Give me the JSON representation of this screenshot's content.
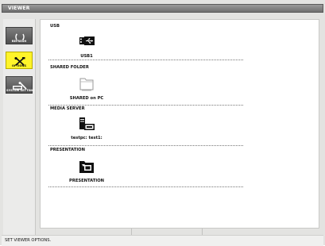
{
  "window": {
    "title": "VIEWER"
  },
  "sidebar": {
    "items": [
      {
        "label": "REFRESH",
        "icon": "refresh-icon",
        "active": false
      },
      {
        "label": "OPTIONS",
        "icon": "tools-icon",
        "active": true
      },
      {
        "label": "SYSTEM SETTING",
        "icon": "system-setting-icon",
        "active": false
      }
    ]
  },
  "main": {
    "sections": [
      {
        "title": "USB",
        "item": {
          "label": "USB1",
          "icon": "usb-icon"
        }
      },
      {
        "title": "SHARED FOLDER",
        "item": {
          "label": "SHARED on PC",
          "icon": "folder-icon"
        }
      },
      {
        "title": "MEDIA SERVER",
        "item": {
          "label": "testpc: test1:",
          "icon": "media-server-icon"
        }
      },
      {
        "title": "PRESENTATION",
        "item": {
          "label": "PRESENTATION",
          "icon": "presentation-icon"
        }
      }
    ]
  },
  "status": {
    "message": "SET VIEWER OPTIONS."
  },
  "colors": {
    "active": "#fff42a",
    "titlebar": "#7a7a7a",
    "background": "#e3e3e1"
  }
}
